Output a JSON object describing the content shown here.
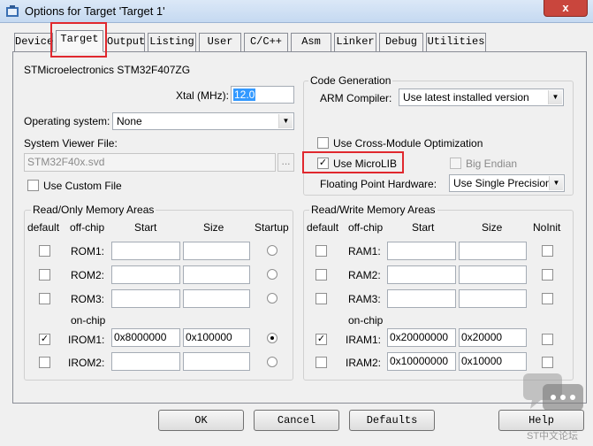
{
  "window": {
    "title": "Options for Target 'Target 1'",
    "close_glyph": "x"
  },
  "tabs": [
    {
      "label": "Device"
    },
    {
      "label": "Target"
    },
    {
      "label": "Output"
    },
    {
      "label": "Listing"
    },
    {
      "label": "User"
    },
    {
      "label": "C/C++"
    },
    {
      "label": "Asm"
    },
    {
      "label": "Linker"
    },
    {
      "label": "Debug"
    },
    {
      "label": "Utilities"
    }
  ],
  "device_name": "STMicroelectronics STM32F407ZG",
  "xtal": {
    "label": "Xtal (MHz):",
    "value": "12.0"
  },
  "os": {
    "label": "Operating system:",
    "value": "None"
  },
  "svd": {
    "label": "System Viewer File:",
    "value": "STM32F40x.svd",
    "browse": "..."
  },
  "custom_file": {
    "label": "Use Custom File",
    "checked": false
  },
  "codegen": {
    "legend": "Code Generation",
    "compiler_label": "ARM Compiler:",
    "compiler_value": "Use latest installed version",
    "cross_module": "Use Cross-Module Optimization",
    "microlib": "Use MicroLIB",
    "microlib_check": "✓",
    "big_endian": "Big Endian",
    "fpu_label": "Floating Point Hardware:",
    "fpu_value": "Use Single Precision"
  },
  "ro": {
    "legend": "Read/Only Memory Areas",
    "headers": {
      "default": "default",
      "offchip": "off-chip",
      "start": "Start",
      "size": "Size",
      "startup": "Startup"
    },
    "onchip": "on-chip",
    "rows": [
      {
        "name": "ROM1:",
        "start": "",
        "size": "",
        "default": "",
        "startup": false
      },
      {
        "name": "ROM2:",
        "start": "",
        "size": "",
        "default": "",
        "startup": false
      },
      {
        "name": "ROM3:",
        "start": "",
        "size": "",
        "default": "",
        "startup": false
      },
      {
        "name": "IROM1:",
        "start": "0x8000000",
        "size": "0x100000",
        "default": "✓",
        "startup": true
      },
      {
        "name": "IROM2:",
        "start": "",
        "size": "",
        "default": "",
        "startup": false
      }
    ]
  },
  "rw": {
    "legend": "Read/Write Memory Areas",
    "headers": {
      "default": "default",
      "offchip": "off-chip",
      "start": "Start",
      "size": "Size",
      "noinit": "NoInit"
    },
    "onchip": "on-chip",
    "rows": [
      {
        "name": "RAM1:",
        "start": "",
        "size": "",
        "default": ""
      },
      {
        "name": "RAM2:",
        "start": "",
        "size": "",
        "default": ""
      },
      {
        "name": "RAM3:",
        "start": "",
        "size": "",
        "default": ""
      },
      {
        "name": "IRAM1:",
        "start": "0x20000000",
        "size": "0x20000",
        "default": "✓"
      },
      {
        "name": "IRAM2:",
        "start": "0x10000000",
        "size": "0x10000",
        "default": ""
      }
    ]
  },
  "buttons": {
    "ok": "OK",
    "cancel": "Cancel",
    "defaults": "Defaults",
    "help": "Help"
  },
  "watermark": "ST中文论坛",
  "colors": {
    "highlight": "#e0282e",
    "selection": "#3399ff"
  }
}
